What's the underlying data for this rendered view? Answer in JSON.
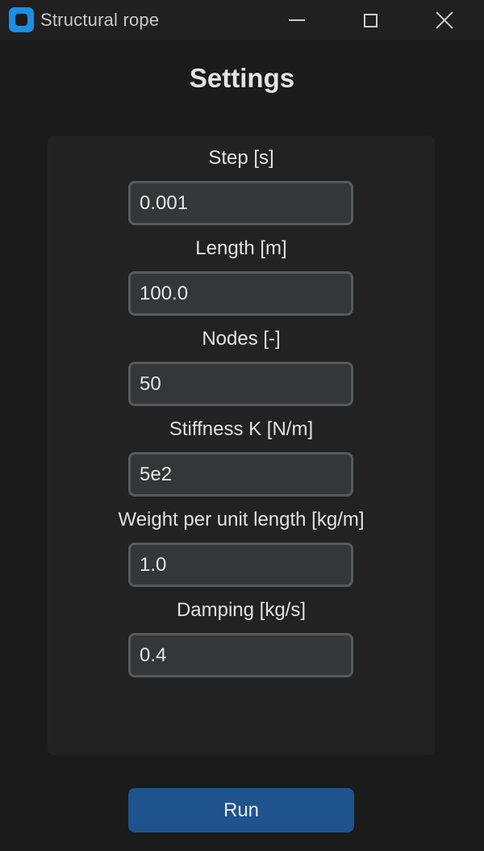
{
  "window": {
    "title": "Structural rope",
    "controls": [
      "minimize",
      "maximize",
      "close"
    ]
  },
  "page": {
    "title": "Settings"
  },
  "fields": [
    {
      "label": "Step [s]",
      "value": "0.001"
    },
    {
      "label": "Length [m]",
      "value": "100.0"
    },
    {
      "label": "Nodes [-]",
      "value": "50"
    },
    {
      "label": "Stiffness K [N/m]",
      "value": "5e2"
    },
    {
      "label": "Weight per unit length [kg/m]",
      "value": "1.0"
    },
    {
      "label": "Damping [kg/s]",
      "value": "0.4"
    }
  ],
  "actions": {
    "run_label": "Run"
  },
  "colors": {
    "accent": "#1f538d",
    "app_icon": "#1a8fe3",
    "background": "#1b1b1b",
    "panel": "#222222",
    "input_bg": "#353638",
    "input_border": "#575a5c"
  }
}
